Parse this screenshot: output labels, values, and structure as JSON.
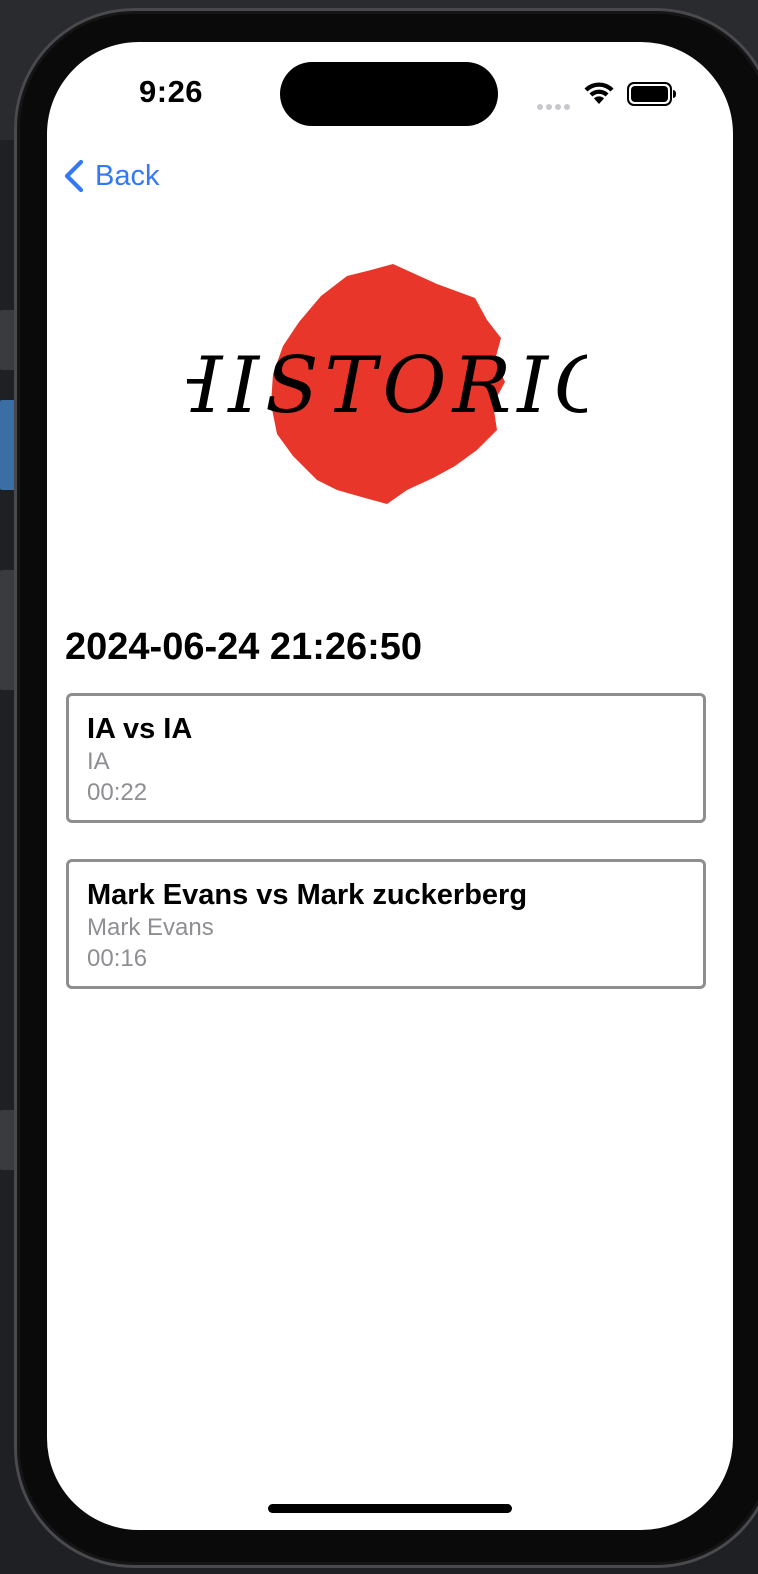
{
  "status_bar": {
    "time": "9:26"
  },
  "navigation": {
    "back_label": "Back"
  },
  "logo": {
    "text": "HISTORIC",
    "accent_color": "#e8362a"
  },
  "section": {
    "date_title": "2024-06-24 21:26:50"
  },
  "games": [
    {
      "title": "IA vs IA",
      "winner": "IA",
      "duration": "00:22"
    },
    {
      "title": "Mark Evans vs Mark zuckerberg",
      "winner": "Mark Evans",
      "duration": "00:16"
    }
  ],
  "colors": {
    "link": "#3478f6",
    "card_border": "#8e8e8e",
    "secondary_text": "#8e8e93"
  }
}
